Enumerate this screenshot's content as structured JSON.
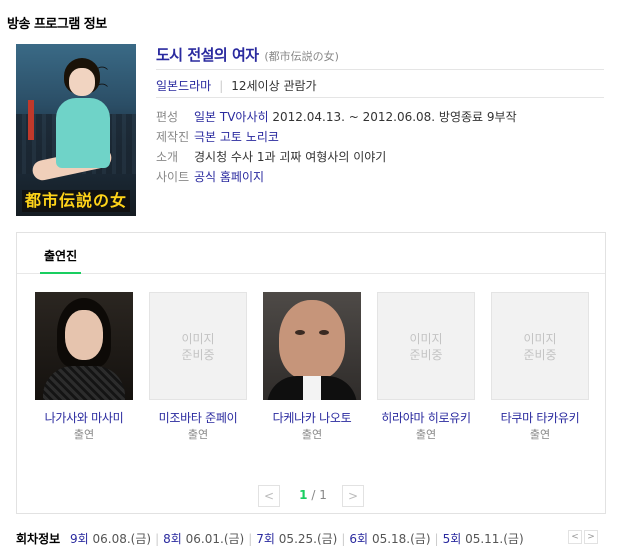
{
  "section_title": "방송 프로그램 정보",
  "program": {
    "title": "도시 전설의 여자",
    "original_title": "(都市伝説の女)",
    "genre": "일본드라마",
    "rating": "12세이상 관람가",
    "poster_title": "都市伝説の女",
    "details": [
      {
        "key": "편성",
        "link": "일본 TV아사히",
        "value": "2012.04.13. ~ 2012.06.08. 방영종료 9부작"
      },
      {
        "key": "제작진",
        "link": "극본 고토 노리코",
        "value": ""
      },
      {
        "key": "소개",
        "link": "",
        "value": "경시청 수사 1과 괴짜 여형사의 이야기"
      },
      {
        "key": "사이트",
        "link": "공식 홈페이지",
        "value": ""
      }
    ]
  },
  "cast": {
    "tab_label": "출연진",
    "members": [
      {
        "name": "나가사와 마사미",
        "role": "출연",
        "photo": "available"
      },
      {
        "name": "미조바타 준페이",
        "role": "출연",
        "photo": "이미지\n준비중"
      },
      {
        "name": "다케나카 나오토",
        "role": "출연",
        "photo": "available"
      },
      {
        "name": "히라야마 히로유키",
        "role": "출연",
        "photo": "이미지\n준비중"
      },
      {
        "name": "타쿠마 타카유키",
        "role": "출연",
        "photo": "이미지\n준비중"
      }
    ],
    "pager": {
      "current": "1",
      "total": "1",
      "prev_icon": "chevron-left-icon",
      "next_icon": "chevron-right-icon"
    }
  },
  "episodes": {
    "label": "회차정보",
    "items": [
      {
        "num": "9회",
        "date": "06.08.(금)"
      },
      {
        "num": "8회",
        "date": "06.01.(금)"
      },
      {
        "num": "7회",
        "date": "05.25.(금)"
      },
      {
        "num": "6회",
        "date": "05.18.(금)"
      },
      {
        "num": "5회",
        "date": "05.11.(금)"
      }
    ]
  },
  "colors": {
    "accent": "#19ce60",
    "link": "#2a2a9f"
  }
}
